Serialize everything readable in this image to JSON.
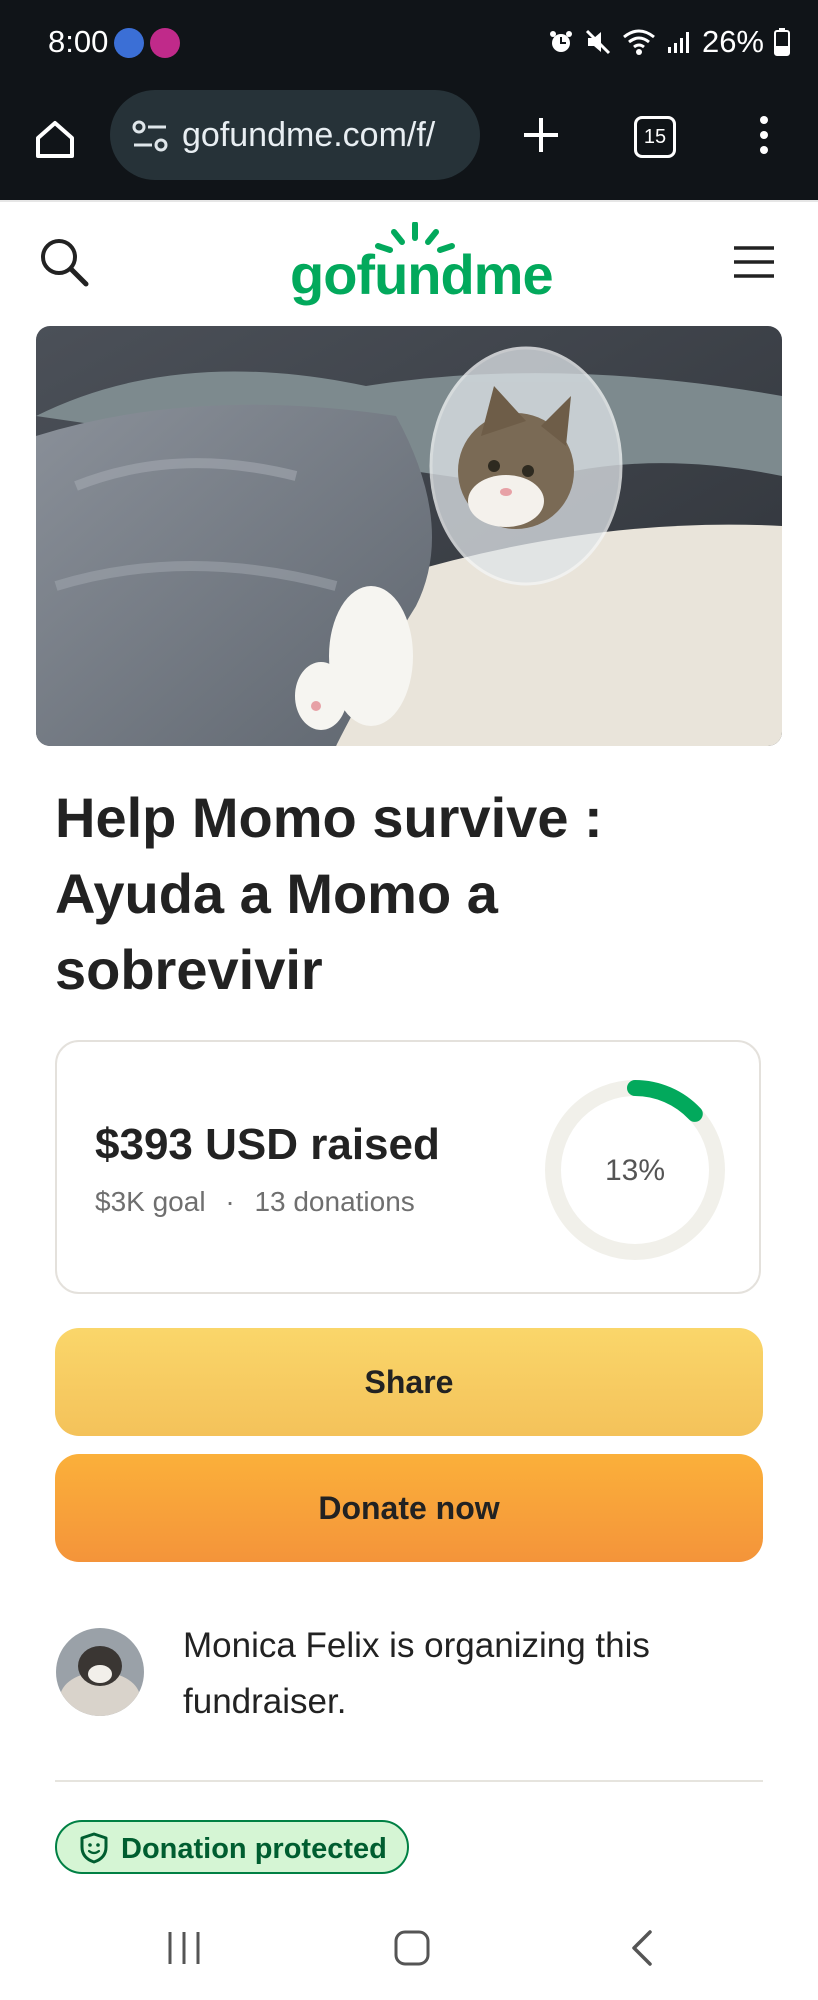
{
  "status_bar": {
    "time": "8:00",
    "battery": "26%"
  },
  "browser": {
    "url": "gofundme.com/f/",
    "tab_count": "15"
  },
  "site": {
    "logo_text": "gofundme",
    "brand_color": "#02a95c"
  },
  "campaign": {
    "title": "Help Momo survive : Ayuda a Momo a sobrevivir",
    "raised": "$393 USD raised",
    "goal": "$3K goal",
    "separator": "·",
    "donations": "13 donations",
    "progress_label": "13%",
    "progress_fraction": 0.13
  },
  "buttons": {
    "share": "Share",
    "donate": "Donate now"
  },
  "organizer": {
    "text": "Monica Felix is organizing this fundraiser."
  },
  "badge": {
    "label": "Donation protected"
  },
  "icons": {
    "home": "home-icon",
    "site_settings": "site-settings-icon",
    "new_tab": "plus-icon",
    "tabs": "tabs-icon",
    "more": "more-vert-icon",
    "search": "search-icon",
    "menu": "hamburger-menu-icon",
    "shield": "shield-icon",
    "recents": "recents-icon",
    "home_nav": "home-nav-icon",
    "back": "back-icon"
  }
}
